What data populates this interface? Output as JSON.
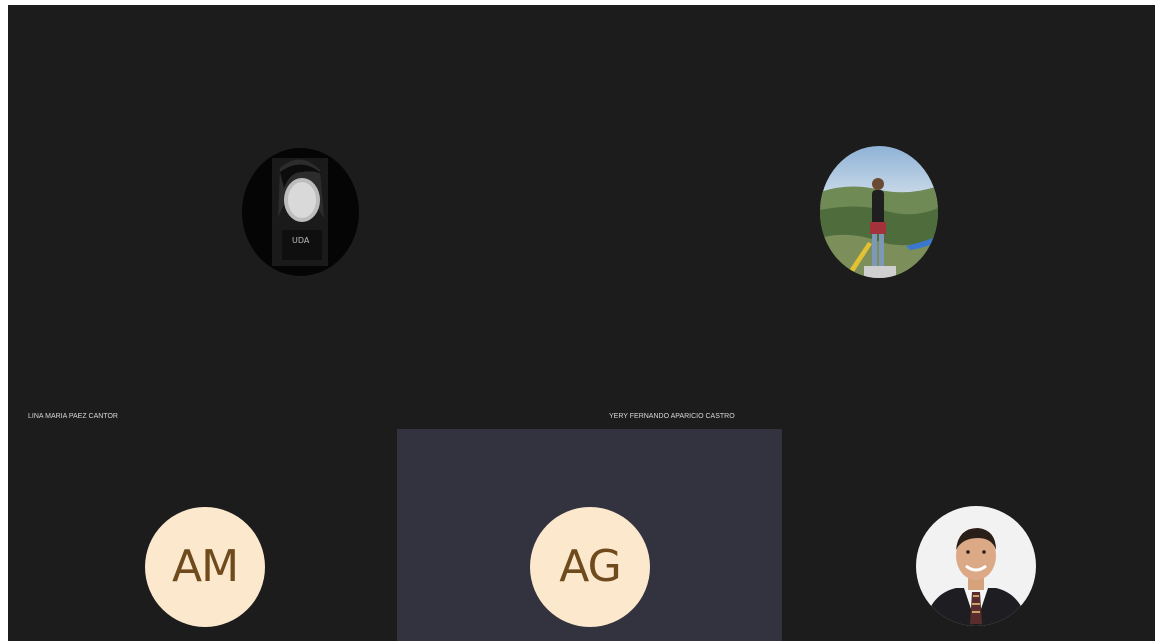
{
  "participants": [
    {
      "name": "LINA MARIA PAEZ CANTOR",
      "avatar": "photo-avatar"
    },
    {
      "name": "YERY FERNANDO APARICIO CASTRO",
      "avatar": "photo-avatar"
    },
    {
      "initials": "AM",
      "avatar": "initials-avatar"
    },
    {
      "initials": "AG",
      "avatar": "initials-avatar",
      "speaking": true
    },
    {
      "avatar": "photo-avatar"
    }
  ],
  "colors": {
    "tile_background": "#1c1c1c",
    "active_tile_background": "#33333f",
    "initials_background": "#fbe8cd",
    "initials_text": "#6e4a1c"
  }
}
